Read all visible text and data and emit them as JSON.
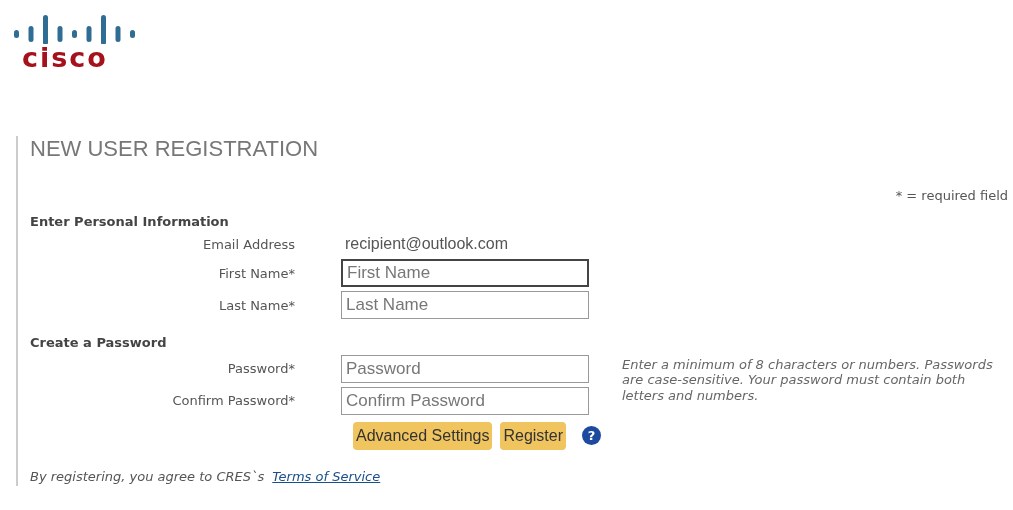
{
  "logo": {
    "text": "cisco"
  },
  "title": "NEW USER REGISTRATION",
  "required_note": "* = required field",
  "sections": [
    {
      "heading": "Enter Personal Information",
      "rows": [
        {
          "kind": "static",
          "label": "Email Address",
          "value": "recipient@outlook.com"
        },
        {
          "kind": "field",
          "label": "First Name*",
          "placeholder": "First Name",
          "focused": true
        },
        {
          "kind": "field",
          "label": "Last Name*",
          "placeholder": "Last Name",
          "focused": false
        }
      ]
    },
    {
      "heading": "Create a Password",
      "rows": [
        {
          "kind": "field",
          "label": "Password*",
          "placeholder": "Password",
          "focused": false
        },
        {
          "kind": "field",
          "label": "Confirm Password*",
          "placeholder": "Confirm Password",
          "focused": false
        }
      ],
      "hint": "Enter a minimum of 8 characters or numbers. Passwords are case-sensitive. Your password must contain both letters and numbers."
    }
  ],
  "buttons": [
    "Advanced Settings",
    "Register"
  ],
  "help": "?",
  "agreement": {
    "text": "By registering, you agree to CRES`s",
    "link": "Terms of Service"
  }
}
